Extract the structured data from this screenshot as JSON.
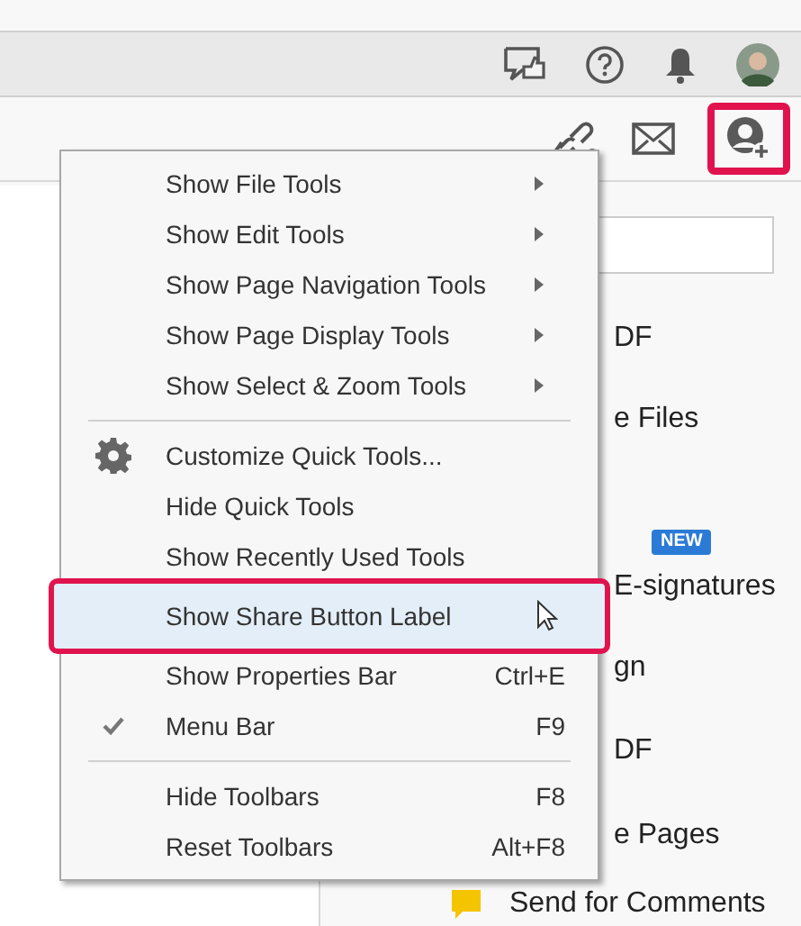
{
  "menu": {
    "items": [
      {
        "kind": "item",
        "label": "Show File Tools",
        "submenu": true,
        "selected": false
      },
      {
        "kind": "item",
        "label": "Show Edit Tools",
        "submenu": true,
        "selected": false
      },
      {
        "kind": "item",
        "label": "Show Page Navigation Tools",
        "submenu": true,
        "selected": false
      },
      {
        "kind": "item",
        "label": "Show Page Display Tools",
        "submenu": true,
        "selected": false
      },
      {
        "kind": "item",
        "label": "Show Select & Zoom Tools",
        "submenu": true,
        "selected": false
      },
      {
        "kind": "separator"
      },
      {
        "kind": "gear_item",
        "label": "Customize Quick Tools...",
        "selected": false
      },
      {
        "kind": "item",
        "label": "Hide Quick Tools",
        "selected": false
      },
      {
        "kind": "item",
        "label": "Show Recently Used Tools",
        "selected": false
      },
      {
        "kind": "item",
        "label": "Show Share Button Label",
        "selected": true
      },
      {
        "kind": "item",
        "label": "Show Properties Bar",
        "shortcut": "Ctrl+E",
        "selected": false
      },
      {
        "kind": "item",
        "label": "Menu Bar",
        "shortcut": "F9",
        "checked": true,
        "selected": false
      },
      {
        "kind": "separator"
      },
      {
        "kind": "item",
        "label": "Hide Toolbars",
        "shortcut": "F8",
        "selected": false
      },
      {
        "kind": "item",
        "label": "Reset Toolbars",
        "shortcut": "Alt+F8",
        "selected": false
      }
    ]
  },
  "tools_panel": {
    "items": [
      {
        "label": "DF"
      },
      {
        "label": "e Files"
      },
      {
        "label": "E-signatures",
        "badge": "NEW"
      },
      {
        "label": "gn"
      },
      {
        "label": "DF"
      },
      {
        "label": "e Pages"
      },
      {
        "kind": "comment_tool",
        "label": "Send for Comments"
      }
    ]
  }
}
